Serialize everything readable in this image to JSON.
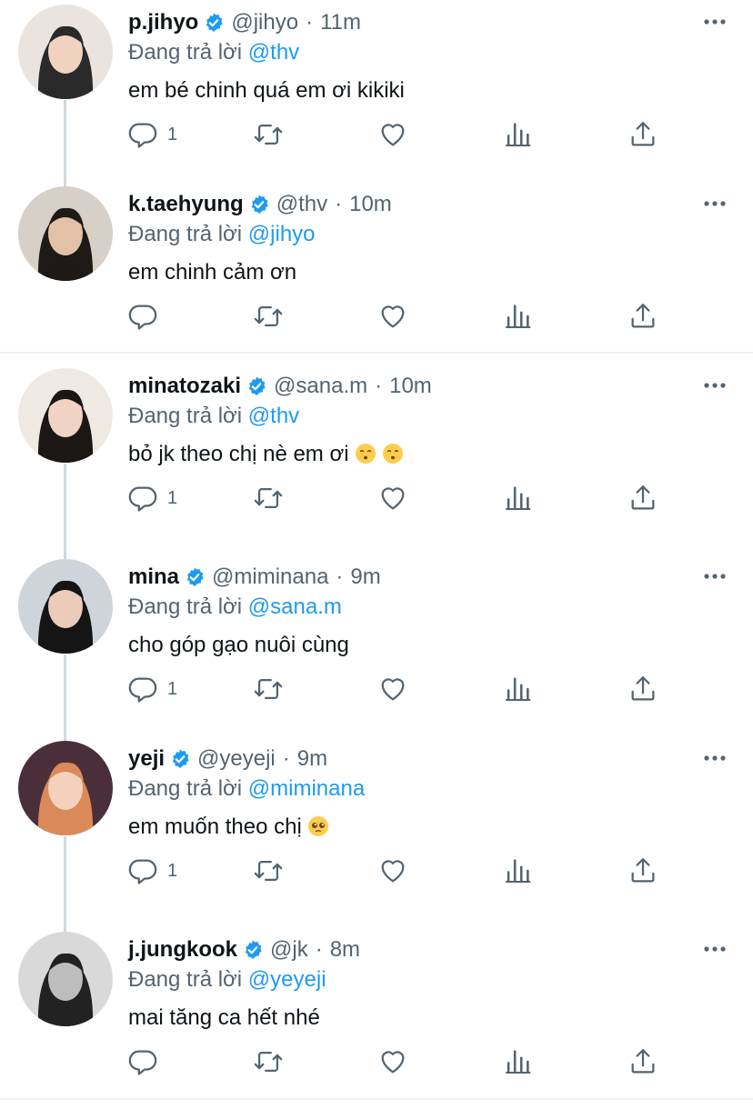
{
  "tweets": [
    {
      "name": "p.jihyo",
      "handle": "@jihyo",
      "time": "11m",
      "reply_prefix": "Đang trả lời",
      "reply_to": "@thv",
      "text": "em bé chinh quá em ơi kikiki",
      "reply_count": "1",
      "avatar": "jihyo-avatar"
    },
    {
      "name": "k.taehyung",
      "handle": "@thv",
      "time": "10m",
      "reply_prefix": "Đang trả lời",
      "reply_to": "@jihyo",
      "text": "em chinh cảm ơn",
      "reply_count": "",
      "avatar": "taehyung-avatar"
    },
    {
      "name": "minatozaki",
      "handle": "@sana.m",
      "time": "10m",
      "reply_prefix": "Đang trả lời",
      "reply_to": "@thv",
      "text": "bỏ jk theo chị nè em ơi",
      "emojis": [
        "kissing-face-emoji",
        "kissing-face-emoji"
      ],
      "reply_count": "1",
      "avatar": "sana-avatar"
    },
    {
      "name": "mina",
      "handle": "@miminana",
      "time": "9m",
      "reply_prefix": "Đang trả lời",
      "reply_to": "@sana.m",
      "text": "cho góp gạo nuôi cùng",
      "reply_count": "1",
      "avatar": "mina-avatar"
    },
    {
      "name": "yeji",
      "handle": "@yeyeji",
      "time": "9m",
      "reply_prefix": "Đang trả lời",
      "reply_to": "@miminana",
      "text": "em muốn theo chị",
      "emojis": [
        "pleading-face-emoji"
      ],
      "reply_count": "1",
      "avatar": "yeji-avatar"
    },
    {
      "name": "j.jungkook",
      "handle": "@jk",
      "time": "8m",
      "reply_prefix": "Đang trả lời",
      "reply_to": "@yeyeji",
      "text": "mai tăng ca hết nhé",
      "reply_count": "",
      "avatar": "jungkook-avatar"
    }
  ],
  "icons": {
    "reply": "reply-icon",
    "retweet": "retweet-icon",
    "like": "heart-icon",
    "views": "analytics-icon",
    "share": "share-icon",
    "more": "more-icon",
    "verified": "verified-badge-icon"
  },
  "colors": {
    "accent": "#1d9bf0",
    "secondary_text": "#536471",
    "primary_text": "#0f1419",
    "thread_line": "#cfd9de"
  }
}
